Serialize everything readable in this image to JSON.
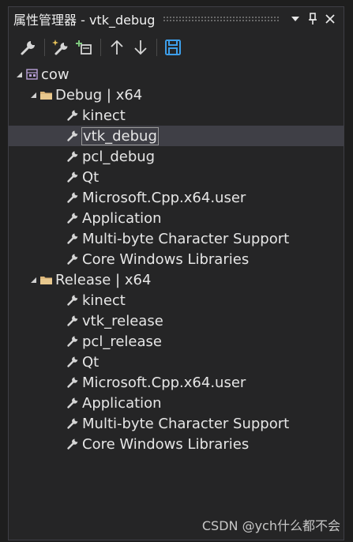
{
  "window": {
    "title": "属性管理器 - vtk_debug"
  },
  "titlebar_icons": [
    "dropdown-arrow-icon",
    "pin-icon",
    "close-icon"
  ],
  "toolbar": {
    "icons": [
      "properties-wrench-icon",
      "new-property-sheet-icon",
      "add-existing-property-sheet-icon",
      "move-up-icon",
      "move-down-icon",
      "save-icon"
    ]
  },
  "tree": {
    "project": {
      "label": "cow"
    },
    "configs": [
      {
        "label": "Debug | x64",
        "sheets": [
          "kinect",
          "vtk_debug",
          "pcl_debug",
          "Qt",
          "Microsoft.Cpp.x64.user",
          "Application",
          "Multi-byte Character Support",
          "Core Windows Libraries"
        ]
      },
      {
        "label": "Release | x64",
        "sheets": [
          "kinect",
          "vtk_release",
          "pcl_release",
          "Qt",
          "Microsoft.Cpp.x64.user",
          "Application",
          "Multi-byte Character Support",
          "Core Windows Libraries"
        ]
      }
    ],
    "selected": "vtk_debug"
  },
  "watermark": "CSDN @ych什么都不会",
  "colors": {
    "background": "#252526",
    "selection": "#3f3f46",
    "save_icon": "#3d9ee9",
    "folder": "#dcb67a"
  }
}
